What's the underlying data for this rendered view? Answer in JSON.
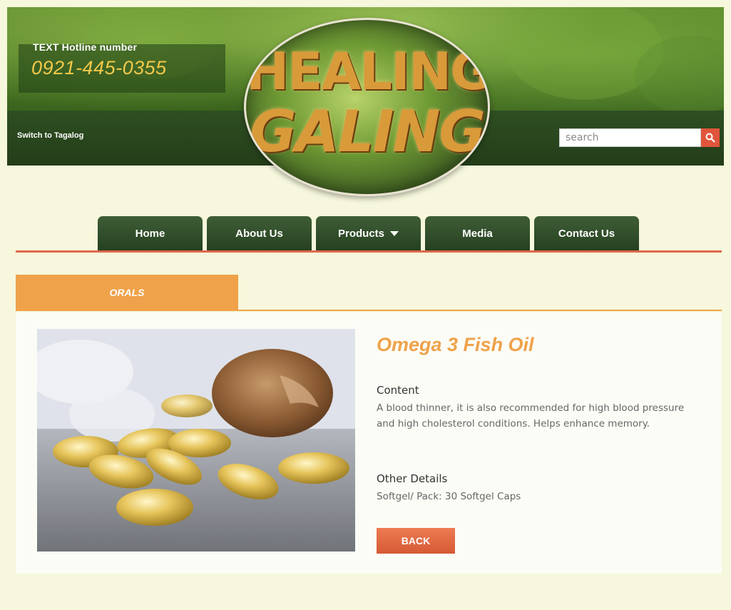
{
  "header": {
    "hotline_label": "TEXT Hotline number",
    "hotline_number": "0921-445-0355",
    "language_switch": "Switch to Tagalog",
    "logo_line1": "HEALING",
    "logo_line2": "GALING",
    "search_placeholder": "search"
  },
  "nav": {
    "items": [
      {
        "label": "Home"
      },
      {
        "label": "About Us"
      },
      {
        "label": "Products"
      },
      {
        "label": "Media"
      },
      {
        "label": "Contact Us"
      }
    ]
  },
  "category": {
    "label": "ORALS"
  },
  "product": {
    "title": "Omega 3 Fish Oil",
    "content_heading": "Content",
    "content_text": "A blood thinner, it is also recommended for high blood pressure and high cholesterol conditions. Helps enhance memory.",
    "details_heading": "Other Details",
    "details_text": "Softgel/ Pack: 30 Softgel Caps",
    "back_label": "BACK"
  },
  "colors": {
    "accent_orange": "#efa24a",
    "nav_green": "#2f4a28",
    "rule_red": "#e0674d",
    "search_red": "#e0553c"
  },
  "icons": {
    "search": "search-icon",
    "dropdown": "caret-down-icon"
  }
}
